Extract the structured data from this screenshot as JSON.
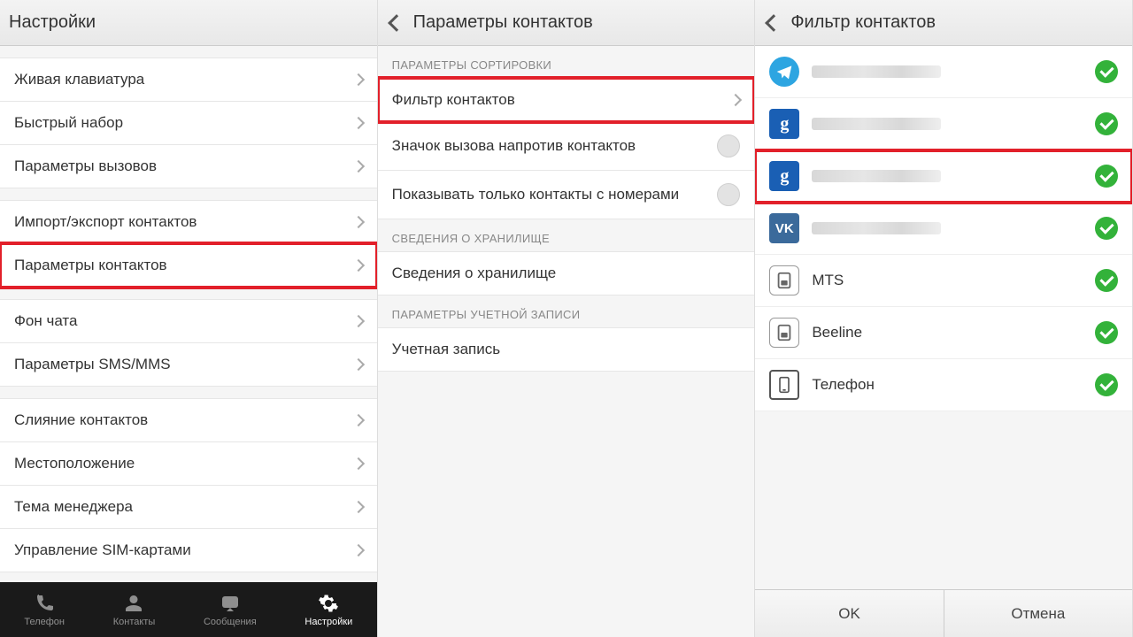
{
  "pane1": {
    "title": "Настройки",
    "items": [
      {
        "label": "Живая клавиатура"
      },
      {
        "label": "Быстрый набор"
      },
      {
        "label": "Параметры вызовов"
      },
      {
        "label": "Импорт/экспорт контактов"
      },
      {
        "label": "Параметры контактов",
        "highlight": true
      },
      {
        "label": "Фон чата"
      },
      {
        "label": "Параметры SMS/MMS"
      },
      {
        "label": "Слияние контактов"
      },
      {
        "label": "Местоположение"
      },
      {
        "label": "Тема менеджера"
      },
      {
        "label": "Управление SIM-картами"
      }
    ],
    "gaps_after": [
      2,
      4,
      6
    ],
    "tabs": [
      {
        "label": "Телефон"
      },
      {
        "label": "Контакты"
      },
      {
        "label": "Сообщения"
      },
      {
        "label": "Настройки",
        "active": true
      }
    ]
  },
  "pane2": {
    "title": "Параметры контактов",
    "sections": [
      {
        "header": "ПАРАМЕТРЫ СОРТИРОВКИ",
        "rows": [
          {
            "label": "Фильтр контактов",
            "type": "nav",
            "highlight": true
          },
          {
            "label": "Значок вызова напротив контактов",
            "type": "toggle"
          },
          {
            "label": "Показывать только контакты с номерами",
            "type": "toggle"
          }
        ]
      },
      {
        "header": "СВЕДЕНИЯ О ХРАНИЛИЩЕ",
        "rows": [
          {
            "label": "Сведения о хранилище",
            "type": "plain"
          }
        ]
      },
      {
        "header": "ПАРАМЕТРЫ УЧЕТНОЙ ЗАПИСИ",
        "rows": [
          {
            "label": "Учетная запись",
            "type": "plain"
          }
        ]
      }
    ]
  },
  "pane3": {
    "title": "Фильтр контактов",
    "accounts": [
      {
        "icon": "telegram",
        "label": "",
        "smudge": true
      },
      {
        "icon": "google",
        "label": "",
        "smudge": true
      },
      {
        "icon": "google",
        "label": "",
        "smudge": true,
        "highlight": true
      },
      {
        "icon": "vk",
        "label": "",
        "smudge": true
      },
      {
        "icon": "sim",
        "label": "MTS"
      },
      {
        "icon": "sim",
        "label": "Beeline"
      },
      {
        "icon": "phone",
        "label": "Телефон"
      }
    ],
    "buttons": {
      "ok": "OK",
      "cancel": "Отмена"
    }
  }
}
